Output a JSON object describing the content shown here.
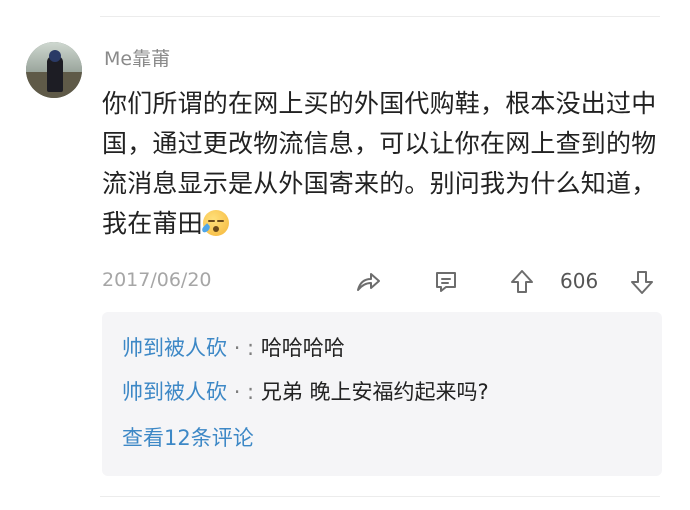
{
  "comment": {
    "username": "Me靠莆",
    "text": "你们所谓的在网上买的外国代购鞋，根本没出过中国，通过更改物流信息，可以让你在网上查到的物流消息显示是从外国寄来的。别问我为什么知道，我在莆田",
    "emoji": "sleepy-face",
    "date": "2017/06/20",
    "upvote_count": "606"
  },
  "icons": {
    "share": "share-arrow-icon",
    "comment": "comment-bubble-icon",
    "upvote": "upvote-arrow-icon",
    "downvote": "downvote-arrow-icon"
  },
  "replies": [
    {
      "author": "帅到被人砍",
      "separator": "· :",
      "text": "哈哈哈哈"
    },
    {
      "author": "帅到被人砍",
      "separator": "· :",
      "text": "兄弟 晚上安福约起来吗?"
    }
  ],
  "view_more_label": "查看12条评论",
  "colors": {
    "link_blue": "#3d88c6",
    "meta_gray": "#a6a6a6",
    "reply_bg": "#f5f5f7"
  }
}
